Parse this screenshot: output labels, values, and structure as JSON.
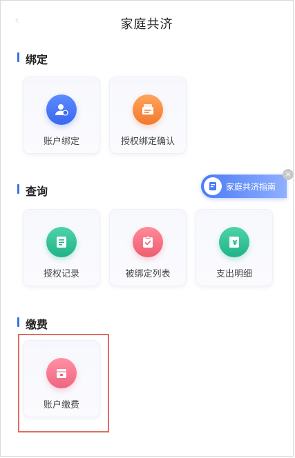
{
  "header": {
    "title": "家庭共济"
  },
  "sections": {
    "bind": {
      "title": "绑定",
      "items": [
        {
          "label": "账户绑定",
          "icon": "user-card-icon"
        },
        {
          "label": "授权绑定确认",
          "icon": "document-stack-icon"
        }
      ]
    },
    "query": {
      "title": "查询",
      "items": [
        {
          "label": "授权记录",
          "icon": "record-list-icon"
        },
        {
          "label": "被绑定列表",
          "icon": "checklist-icon"
        },
        {
          "label": "支出明细",
          "icon": "yuan-ledger-icon"
        }
      ]
    },
    "pay": {
      "title": "缴费",
      "items": [
        {
          "label": "账户缴费",
          "icon": "wallet-icon"
        }
      ]
    }
  },
  "guide": {
    "label": "家庭共济指南"
  },
  "colors": {
    "accent": "#3b6ee8",
    "highlight": "#e06b62"
  }
}
